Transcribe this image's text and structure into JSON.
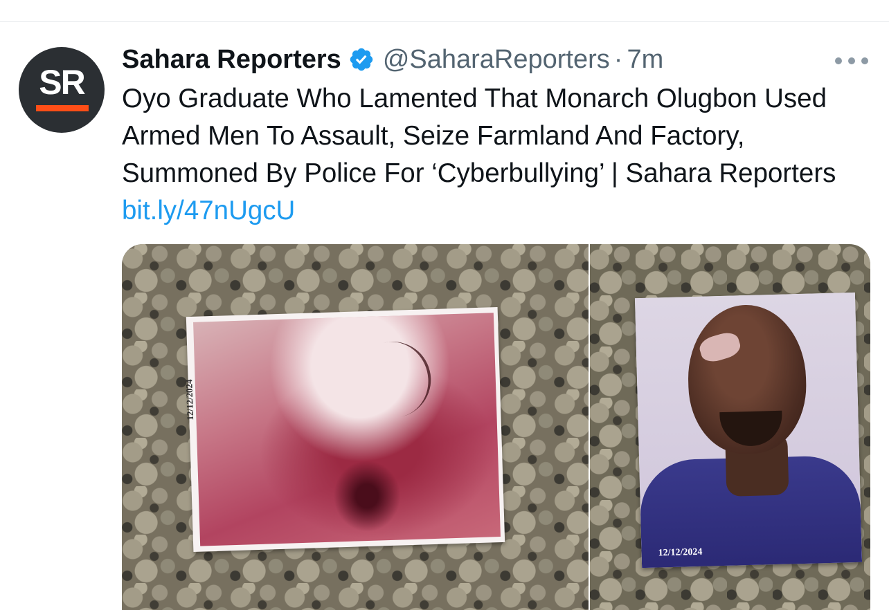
{
  "tweet": {
    "avatar_text": "SR",
    "author_name": "Sahara Reporters",
    "handle": "@SaharaReporters",
    "separator": "·",
    "time": "7m",
    "text": "Oyo Graduate Who Lamented That Monarch Olugbon Used Armed Men To Assault, Seize Farmland And Factory, Summoned By Police For ‘Cyberbullying’ | Sahara Reporters",
    "link": "bit.ly/47nUgcU"
  },
  "media": {
    "photo_left_date": "12/12/2024",
    "photo_right_date": "12/12/2024"
  },
  "icons": {
    "verified": "verified-badge-icon",
    "more": "more-options-icon"
  },
  "colors": {
    "verified_blue": "#1d9bf0",
    "link_blue": "#1d9bf0",
    "brand_orange": "#ff4e17",
    "avatar_dark": "#2b2f33"
  }
}
